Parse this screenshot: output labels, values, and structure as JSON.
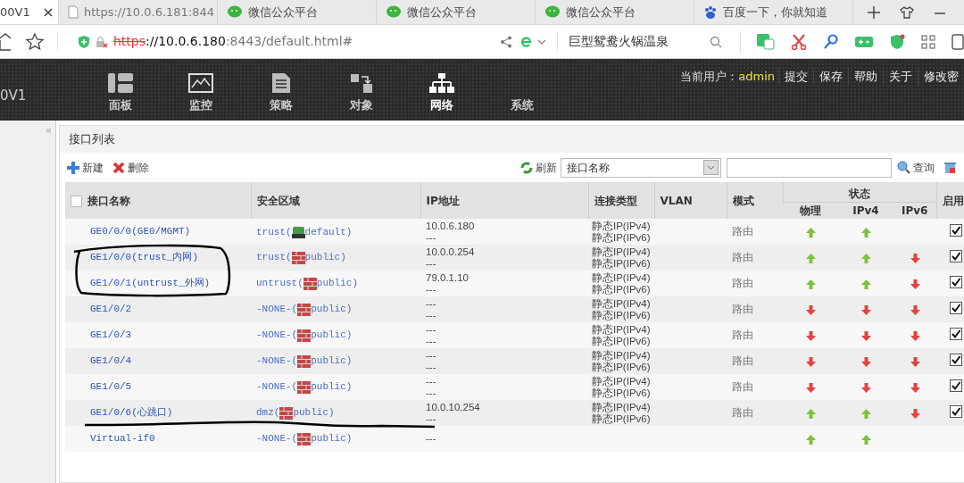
{
  "browser": {
    "tabs": [
      {
        "label": "00V1",
        "kind": "page",
        "selected": true
      },
      {
        "label": "https://10.0.6.181:844",
        "kind": "page",
        "selected": false
      },
      {
        "label": "微信公众平台",
        "kind": "wechat",
        "selected": false
      },
      {
        "label": "微信公众平台",
        "kind": "wechat",
        "selected": false
      },
      {
        "label": "微信公众平台",
        "kind": "wechat",
        "selected": false
      },
      {
        "label": "百度一下，你就知道",
        "kind": "baidu",
        "selected": false
      }
    ],
    "address": {
      "scheme": "https",
      "host": "://10.0.6.180",
      "rest": ":8443/default.html#"
    },
    "search": {
      "value": "巨型鸳鸯火锅温泉"
    }
  },
  "app": {
    "brand": "0V1",
    "nav": [
      {
        "label": "面板",
        "kind": "dashboard",
        "selected": false
      },
      {
        "label": "监控",
        "kind": "monitor",
        "selected": false
      },
      {
        "label": "策略",
        "kind": "policy",
        "selected": false
      },
      {
        "label": "对象",
        "kind": "object",
        "selected": false
      },
      {
        "label": "网络",
        "kind": "network",
        "selected": true
      },
      {
        "label": "系统",
        "kind": "system",
        "selected": false
      }
    ],
    "user_label": "当前用户：",
    "user": "admin",
    "links": [
      "提交",
      "保存",
      "帮助",
      "关于",
      "修改密"
    ]
  },
  "sidebar": {
    "collapse_glyph": "«"
  },
  "panel": {
    "title": "接口列表",
    "actions": [
      {
        "label": "新建",
        "kind": "add"
      },
      {
        "label": "删除",
        "kind": "delete"
      }
    ],
    "refresh": "刷新",
    "filter": {
      "value": "接口名称"
    },
    "query": "查询"
  },
  "table": {
    "select_all": {
      "checked": false
    },
    "columns": [
      "接口名称",
      "安全区域",
      "IP地址",
      "连接类型",
      "VLAN",
      "模式"
    ],
    "status_group": "状态",
    "status_columns": [
      "物理",
      "IPv4",
      "IPv6"
    ],
    "enable_column": "启用",
    "rows": [
      {
        "name": "GE0/0/0(GE0/MGMT)",
        "zone": "trust(",
        "vsys": "default)",
        "kind": "default",
        "ip": [
          "10.0.6.180",
          "---"
        ],
        "types": [
          "静态IP(IPv4)",
          "静态IP(IPv6)"
        ],
        "mode": "路由",
        "physical_up": true,
        "ipv4_up": true,
        "enabled": true
      },
      {
        "name": "GE1/0/0(trust_内网)",
        "zone": "trust(",
        "vsys": "public)",
        "kind": "public",
        "ip": [
          "10.0.0.254",
          "---"
        ],
        "types": [
          "静态IP(IPv4)",
          "静态IP(IPv6)"
        ],
        "mode": "路由",
        "physical_up": true,
        "ipv4_up": true,
        "ipv6_up": false,
        "enabled": true,
        "circled": true
      },
      {
        "name": "GE1/0/1(untrust_外网)",
        "zone": "untrust(",
        "vsys": "public)",
        "kind": "public",
        "ip": [
          "79.0.1.10",
          "---"
        ],
        "types": [
          "静态IP(IPv4)",
          "静态IP(IPv6)"
        ],
        "mode": "路由",
        "physical_up": true,
        "ipv4_up": true,
        "ipv6_up": false,
        "enabled": true,
        "circled": true
      },
      {
        "name": "GE1/0/2",
        "zone": "-NONE-(",
        "vsys": "public)",
        "kind": "public",
        "ip": [
          "---",
          "---"
        ],
        "types": [
          "静态IP(IPv4)",
          "静态IP(IPv6)"
        ],
        "mode": "路由",
        "physical_up": false,
        "ipv4_up": false,
        "ipv6_up": false,
        "enabled": true
      },
      {
        "name": "GE1/0/3",
        "zone": "-NONE-(",
        "vsys": "public)",
        "kind": "public",
        "ip": [
          "---",
          "---"
        ],
        "types": [
          "静态IP(IPv4)",
          "静态IP(IPv6)"
        ],
        "mode": "路由",
        "physical_up": false,
        "ipv4_up": false,
        "ipv6_up": false,
        "enabled": true
      },
      {
        "name": "GE1/0/4",
        "zone": "-NONE-(",
        "vsys": "public)",
        "kind": "public",
        "ip": [
          "---",
          "---"
        ],
        "types": [
          "静态IP(IPv4)",
          "静态IP(IPv6)"
        ],
        "mode": "路由",
        "physical_up": false,
        "ipv4_up": false,
        "ipv6_up": false,
        "enabled": true
      },
      {
        "name": "GE1/0/5",
        "zone": "-NONE-(",
        "vsys": "public)",
        "kind": "public",
        "ip": [
          "---",
          "---"
        ],
        "types": [
          "静态IP(IPv4)",
          "静态IP(IPv6)"
        ],
        "mode": "路由",
        "physical_up": false,
        "ipv4_up": false,
        "ipv6_up": false,
        "enabled": true
      },
      {
        "name": "GE1/0/6(心跳口)",
        "zone": "dmz(",
        "vsys": "public)",
        "kind": "public",
        "ip": [
          "10.0.10.254",
          "---"
        ],
        "types": [
          "静态IP(IPv4)",
          "静态IP(IPv6)"
        ],
        "mode": "路由",
        "physical_up": true,
        "ipv4_up": true,
        "ipv6_up": false,
        "enabled": true,
        "underlined": true
      },
      {
        "name": "Virtual-if0",
        "zone": "-NONE-(",
        "vsys": "public)",
        "kind": "public",
        "ip": [
          "---"
        ],
        "types": [],
        "physical_up": true,
        "ipv4_up": true
      }
    ]
  }
}
